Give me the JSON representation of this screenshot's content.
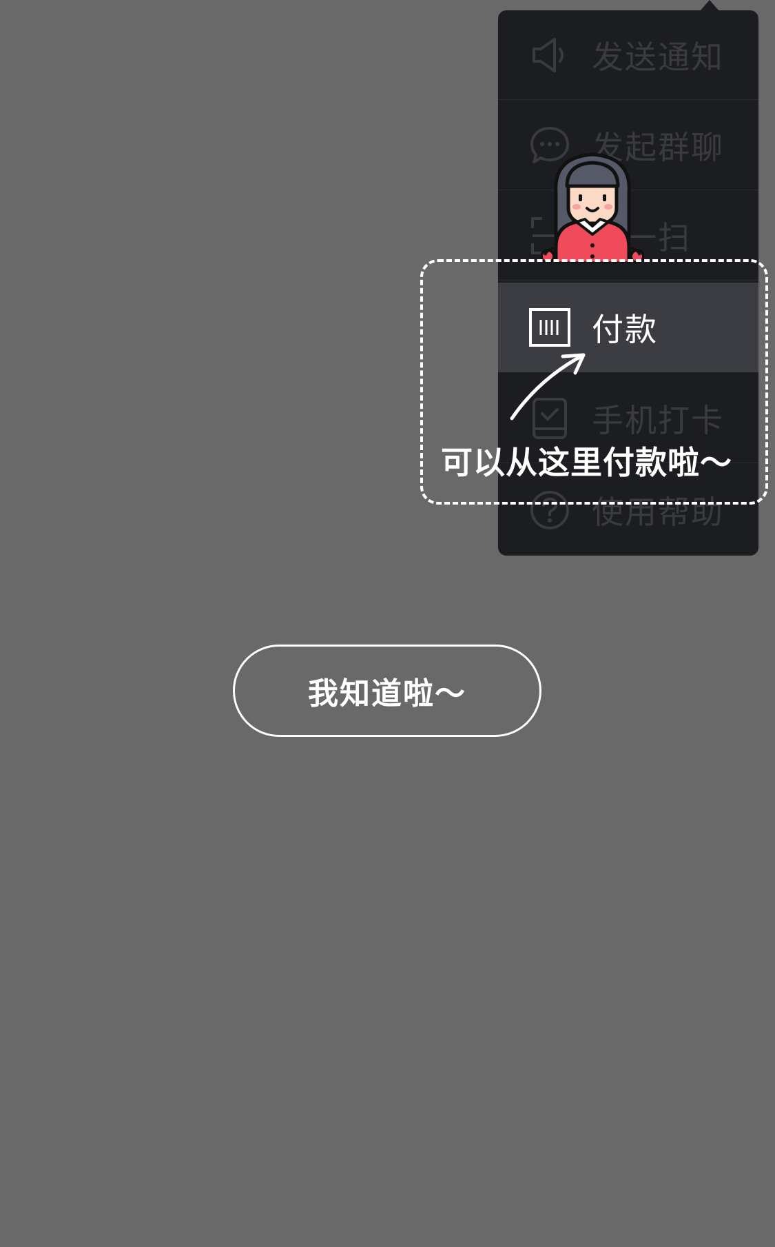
{
  "menu": {
    "items": [
      {
        "label": "发送通知",
        "icon": "megaphone-icon"
      },
      {
        "label": "发起群聊",
        "icon": "chat-bubble-icon"
      },
      {
        "label": "扫一扫",
        "icon": "scan-icon"
      },
      {
        "label": "付款",
        "icon": "barcode-icon",
        "active": true
      },
      {
        "label": "手机打卡",
        "icon": "phone-checkin-icon"
      },
      {
        "label": "使用帮助",
        "icon": "help-icon"
      }
    ]
  },
  "guide": {
    "hint": "可以从这里付款啦～",
    "button_label": "我知道啦～",
    "mascot": "girl-mascot-illustration"
  },
  "colors": {
    "overlay": "#696969",
    "menu_bg": "#1c1d20",
    "active_item_bg": "#3c3d43",
    "mascot_shirt": "#ef4b5a",
    "mascot_hair": "#565a68"
  }
}
